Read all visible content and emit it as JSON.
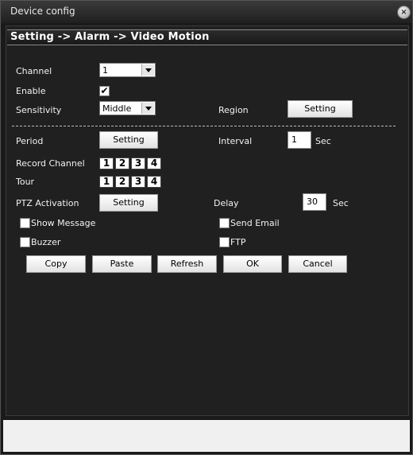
{
  "window": {
    "title": "Device config",
    "close_glyph": "×"
  },
  "breadcrumb": "Setting -> Alarm -> Video Motion",
  "form": {
    "channel_label": "Channel",
    "channel_value": "1",
    "enable_label": "Enable",
    "enable_checked": true,
    "sensitivity_label": "Sensitivity",
    "sensitivity_value": "Middle",
    "region_label": "Region",
    "region_button": "Setting",
    "period_label": "Period",
    "period_button": "Setting",
    "interval_label": "Interval",
    "interval_value": "1",
    "interval_unit": "Sec",
    "record_channel_label": "Record Channel",
    "record_channels": [
      "1",
      "2",
      "3",
      "4"
    ],
    "tour_label": "Tour",
    "tour_channels": [
      "1",
      "2",
      "3",
      "4"
    ],
    "ptz_label": "PTZ Activation",
    "ptz_button": "Setting",
    "delay_label": "Delay",
    "delay_value": "30",
    "delay_unit": "Sec",
    "show_message_label": "Show Message",
    "send_email_label": "Send Email",
    "buzzer_label": "Buzzer",
    "ftp_label": "FTP"
  },
  "actions": {
    "copy": "Copy",
    "paste": "Paste",
    "refresh": "Refresh",
    "ok": "OK",
    "cancel": "Cancel"
  },
  "colors": {
    "background": "#1a1a1a",
    "panel": "#202020",
    "text": "#f2f2f2",
    "button": "#ffffff"
  }
}
